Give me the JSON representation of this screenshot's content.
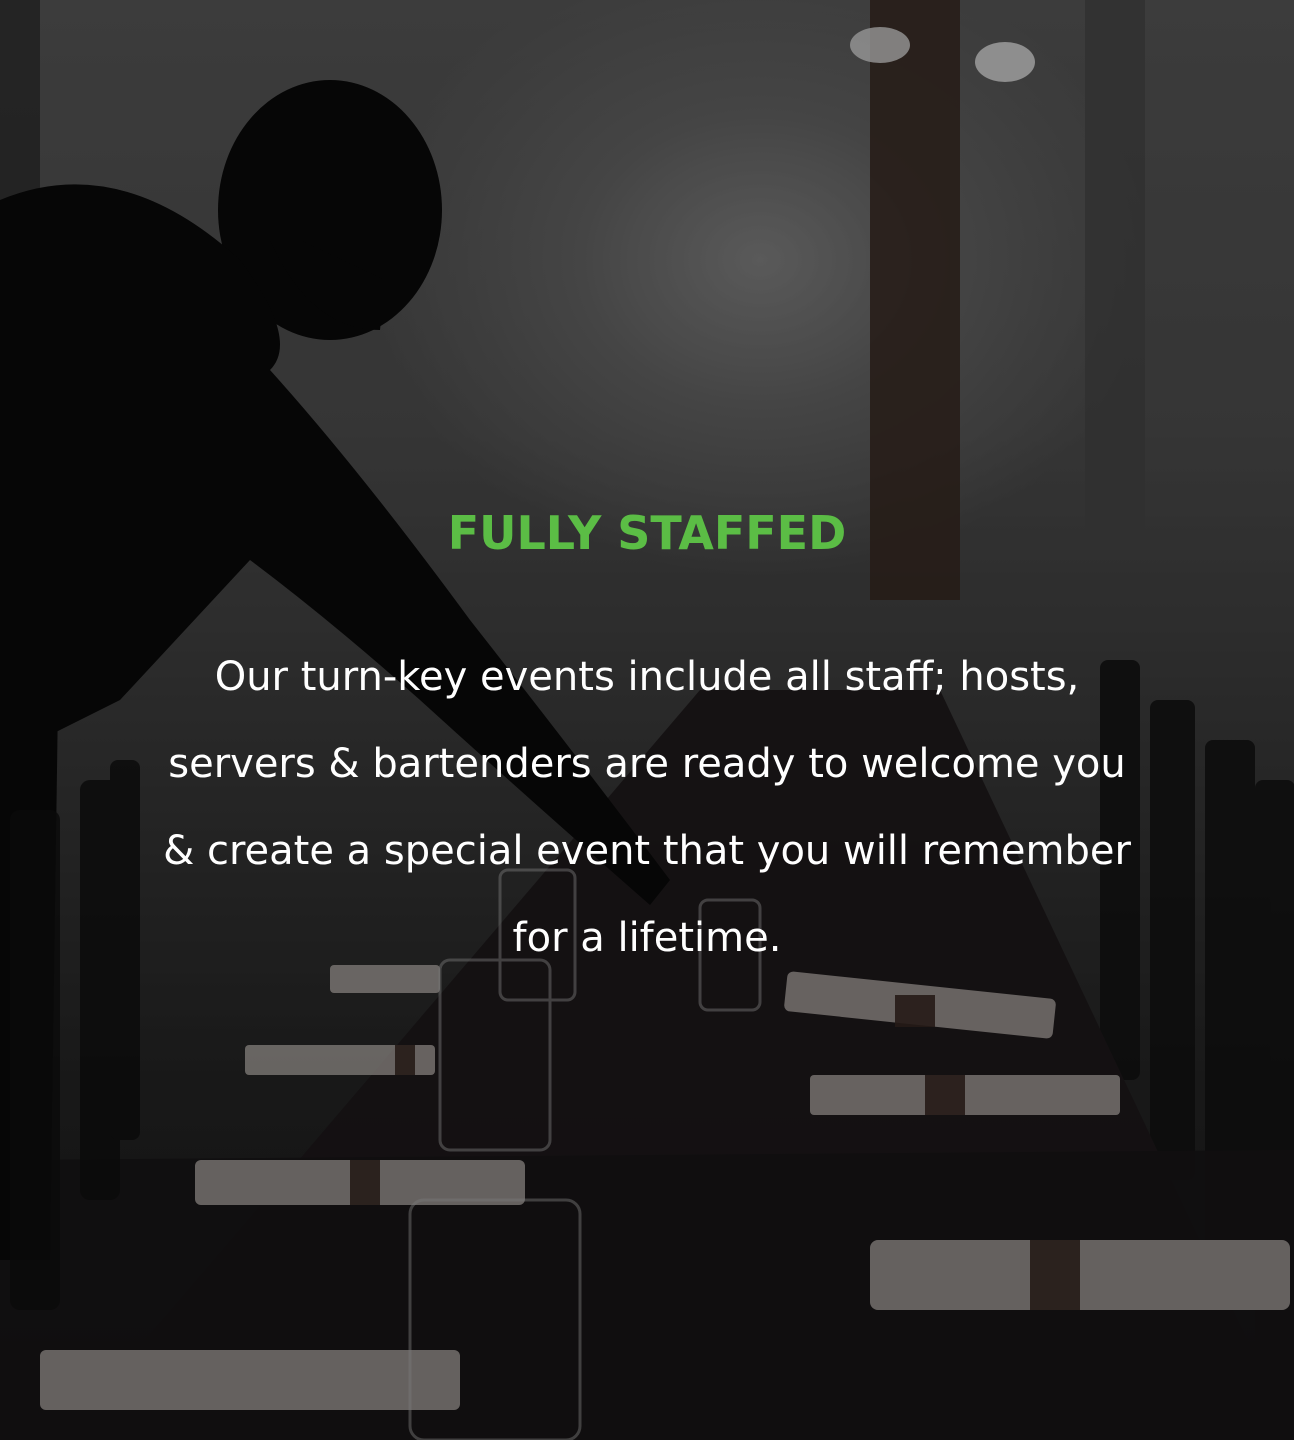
{
  "section": {
    "eyebrow": "FULLY STAFFED",
    "body": "Our turn-key events include all staff; hosts, servers & bartenders are ready to welcome you & create a special event that you will remember for a lifetime."
  },
  "colors": {
    "accent": "#5bbd45",
    "text": "#ffffff"
  }
}
